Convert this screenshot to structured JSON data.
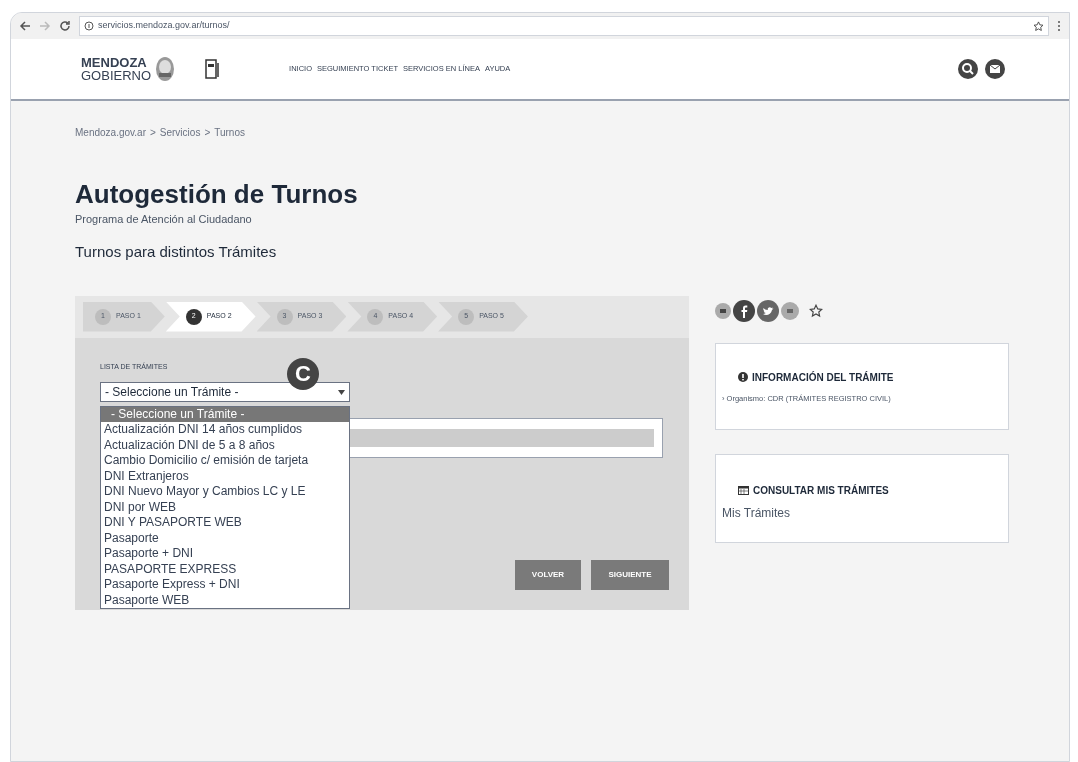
{
  "browser": {
    "url": "servicios.mendoza.gov.ar/turnos/"
  },
  "header": {
    "logo_top": "MENDOZA",
    "logo_bottom": "GOBIERNO",
    "nav": [
      "INICIO",
      "SEGUIMIENTO TICKET",
      "SERVICIOS EN LÍNEA",
      "AYUDA"
    ]
  },
  "breadcrumb": [
    "Mendoza.gov.ar",
    "Servicios",
    "Turnos"
  ],
  "breadcrumb_separator": ">",
  "title": "Autogestión de Turnos",
  "subtitle": "Programa de Atención al Ciudadano",
  "section_title": "Turnos para distintos Trámites",
  "steps": [
    {
      "number": "1",
      "label": "PASO 1",
      "selected": false
    },
    {
      "number": "2",
      "label": "PASO 2",
      "selected": true
    },
    {
      "number": "3",
      "label": "PASO 3",
      "selected": false
    },
    {
      "number": "4",
      "label": "PASO 4",
      "selected": false
    },
    {
      "number": "5",
      "label": "PASO 5",
      "selected": false
    }
  ],
  "form": {
    "label": "LISTA DE TRÁMITES",
    "select_value": "- Seleccione un Trámite -",
    "annotation": "C",
    "options": [
      {
        "label": "- Seleccione un Trámite -",
        "selected": true
      },
      {
        "label": "Actualización DNI 14 años cumplidos",
        "selected": false
      },
      {
        "label": "Actualización DNI de 5 a 8 años",
        "selected": false
      },
      {
        "label": "Cambio Domicilio c/ emisión de tarjeta",
        "selected": false
      },
      {
        "label": "DNI Extranjeros",
        "selected": false
      },
      {
        "label": "DNI Nuevo Mayor y Cambios LC y LE",
        "selected": false
      },
      {
        "label": "DNI por WEB",
        "selected": false
      },
      {
        "label": "DNI Y PASAPORTE WEB",
        "selected": false
      },
      {
        "label": "Pasaporte",
        "selected": false
      },
      {
        "label": "Pasaporte + DNI",
        "selected": false
      },
      {
        "label": "PASAPORTE EXPRESS",
        "selected": false
      },
      {
        "label": "Pasaporte Express + DNI",
        "selected": false
      },
      {
        "label": "Pasaporte WEB",
        "selected": false
      }
    ],
    "buttons": [
      "VOLVER",
      "SIGUIENTE"
    ]
  },
  "info_card": {
    "title": "INFORMACIÓN DEL TRÁMITE",
    "line": "› Organismo: CDR (TRÁMITES REGISTRO CIVIL)"
  },
  "consult_card": {
    "title": "CONSULTAR MIS TRÁMITES",
    "link": "Mis Trámites"
  }
}
